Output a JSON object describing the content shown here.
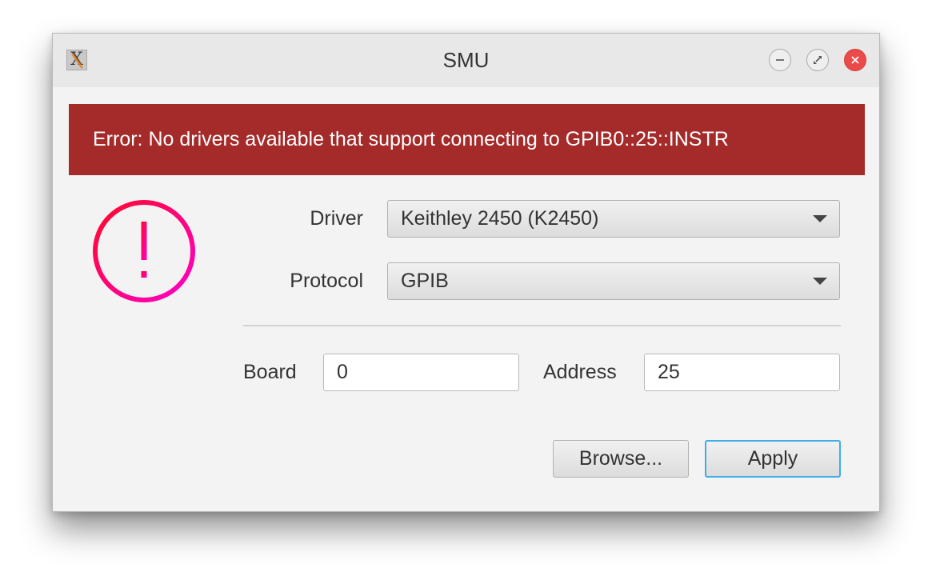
{
  "window": {
    "title": "SMU"
  },
  "error": {
    "message": "Error: No drivers available that support connecting to GPIB0::25::INSTR"
  },
  "form": {
    "driver_label": "Driver",
    "driver_value": "Keithley 2450 (K2450)",
    "protocol_label": "Protocol",
    "protocol_value": "GPIB",
    "board_label": "Board",
    "board_value": "0",
    "address_label": "Address",
    "address_value": "25"
  },
  "buttons": {
    "browse_label": "Browse...",
    "apply_label": "Apply"
  },
  "icons": {
    "app": "x11-app-icon",
    "status": "warning-exclamation-icon"
  },
  "colors": {
    "error_banner": "#a52a2a",
    "warning_gradient_start": "#ff0a2a",
    "warning_gradient_end": "#ff00c8",
    "close_button": "#ea4a4a",
    "focus_border": "#3daee9"
  }
}
